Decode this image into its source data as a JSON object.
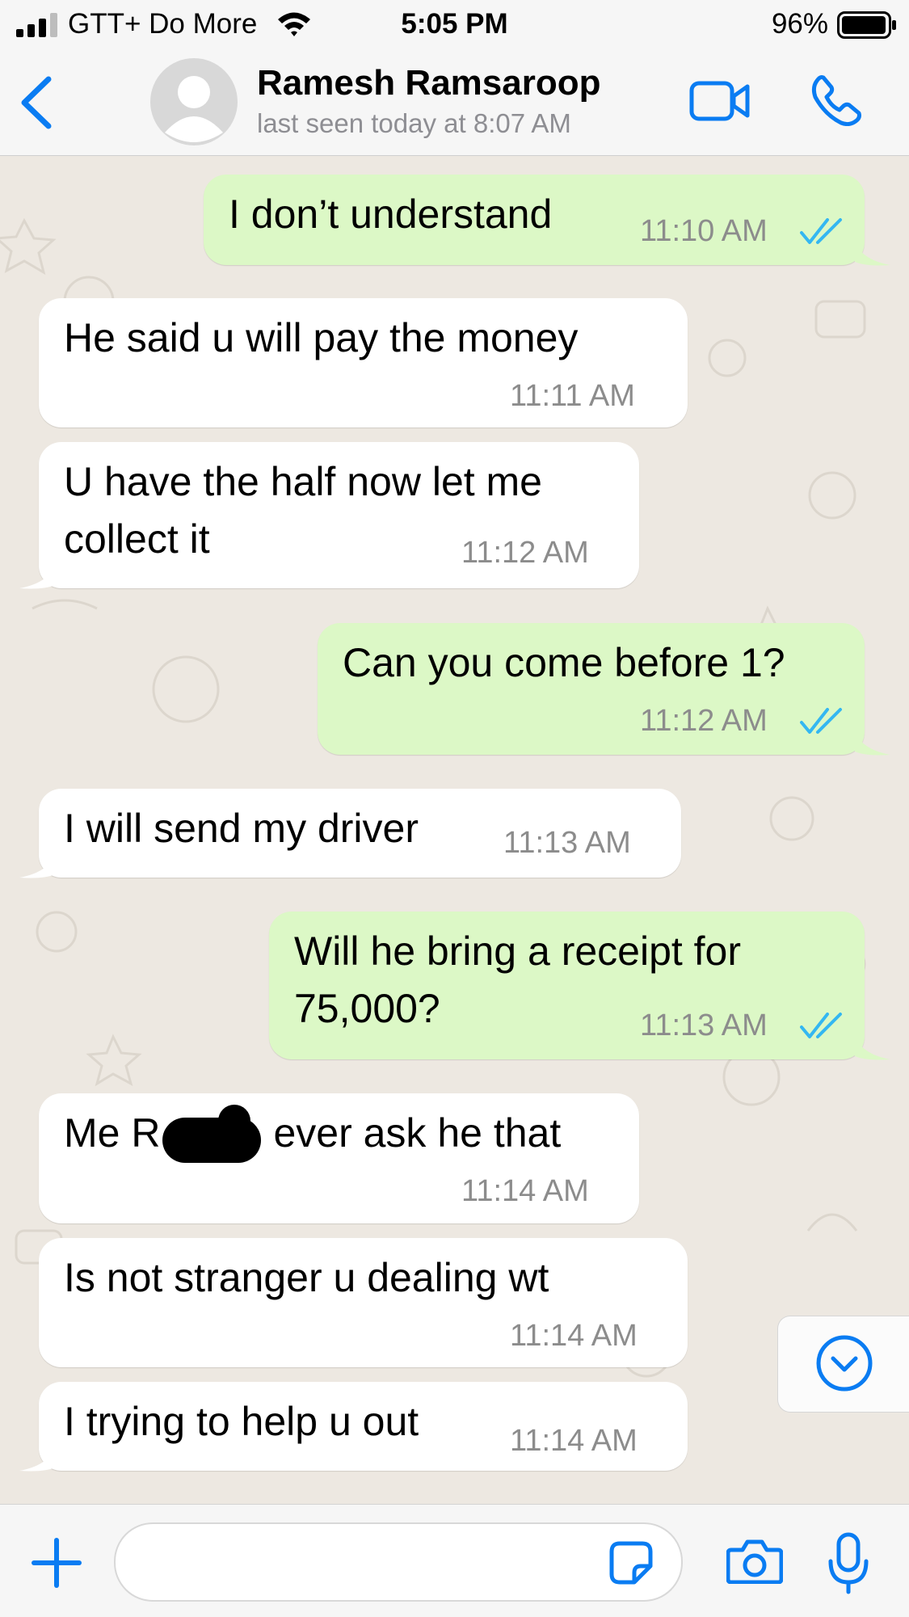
{
  "status_bar": {
    "carrier": "GTT+ Do More",
    "time": "5:05 PM",
    "battery": "96%"
  },
  "header": {
    "contact_name": "Ramesh Ramsaroop",
    "last_seen": "last seen today at 8:07 AM"
  },
  "colors": {
    "accent": "#0a7cf2",
    "outgoing_bubble": "#dcf8c6",
    "incoming_bubble": "#ffffff",
    "chat_background": "#ede8e1",
    "read_ticks": "#34b7f1"
  },
  "messages": [
    {
      "direction": "out",
      "text": "I don’t understand",
      "time": "11:10 AM",
      "read": true
    },
    {
      "direction": "in",
      "text": "He said u will pay the money",
      "time": "11:11 AM"
    },
    {
      "direction": "in",
      "lines": [
        "U have the half now let me",
        "collect it"
      ],
      "time": "11:12 AM"
    },
    {
      "direction": "out",
      "text": "Can you come before 1?",
      "time": "11:12 AM",
      "read": true
    },
    {
      "direction": "in",
      "text": "I will send my driver",
      "time": "11:13 AM"
    },
    {
      "direction": "out",
      "lines": [
        "Will he bring a receipt for",
        "75,000?"
      ],
      "time": "11:13 AM",
      "read": true
    },
    {
      "direction": "in",
      "text_before_redaction": "Me R",
      "text_after_redaction": "ever ask he that",
      "time": "11:14 AM",
      "redacted": true
    },
    {
      "direction": "in",
      "text": "Is not stranger u dealing wt",
      "time": "11:14 AM"
    },
    {
      "direction": "in",
      "text": "I trying to help u out",
      "time": "11:14 AM"
    }
  ],
  "icons": {
    "signal": "signal-icon",
    "wifi": "wifi-icon",
    "battery": "battery-icon",
    "back": "chevron-left-icon",
    "avatar": "avatar-placeholder-icon",
    "video": "video-camera-icon",
    "phone": "phone-icon",
    "scroll_down": "chevron-down-circle-icon",
    "attach": "plus-icon",
    "sticker": "sticker-icon",
    "camera": "camera-icon",
    "mic": "microphone-icon"
  }
}
